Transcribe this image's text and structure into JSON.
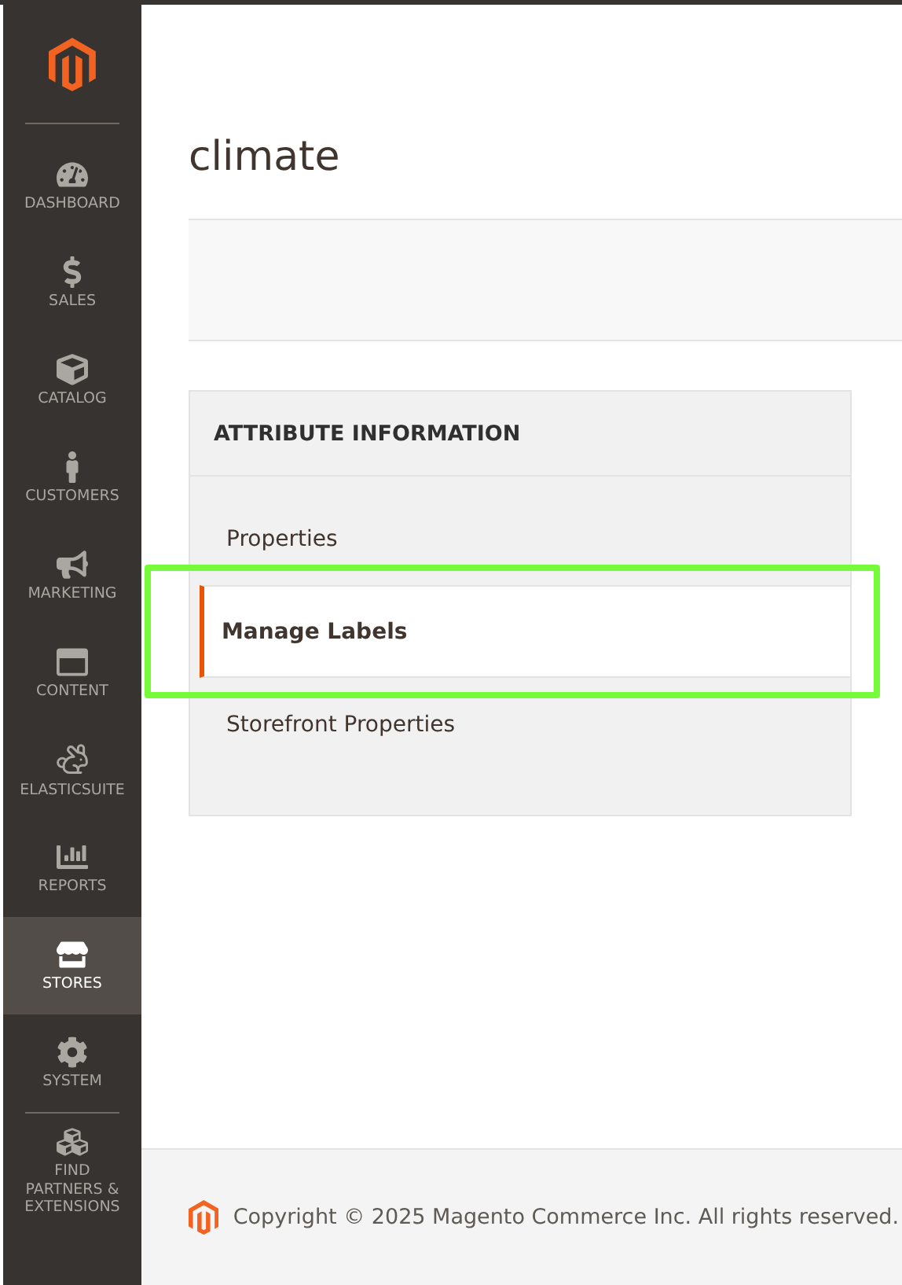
{
  "sidebar": {
    "items": [
      {
        "label": "DASHBOARD",
        "selected": false
      },
      {
        "label": "SALES",
        "selected": false
      },
      {
        "label": "CATALOG",
        "selected": false
      },
      {
        "label": "CUSTOMERS",
        "selected": false
      },
      {
        "label": "MARKETING",
        "selected": false
      },
      {
        "label": "CONTENT",
        "selected": false
      },
      {
        "label": "ELASTICSUITE",
        "selected": false
      },
      {
        "label": "REPORTS",
        "selected": false
      },
      {
        "label": "STORES",
        "selected": true
      },
      {
        "label": "SYSTEM",
        "selected": false
      },
      {
        "label": "FIND PARTNERS & EXTENSIONS",
        "selected": false
      }
    ]
  },
  "page": {
    "title": "climate"
  },
  "tabs": {
    "heading": "ATTRIBUTE INFORMATION",
    "items": [
      {
        "label": "Properties",
        "selected": false,
        "highlighted": false
      },
      {
        "label": "Manage Labels",
        "selected": true,
        "highlighted": true
      },
      {
        "label": "Storefront Properties",
        "selected": false,
        "highlighted": false
      }
    ]
  },
  "footer": {
    "copyright": "Copyright © 2025 Magento Commerce Inc. All rights reserved."
  }
}
